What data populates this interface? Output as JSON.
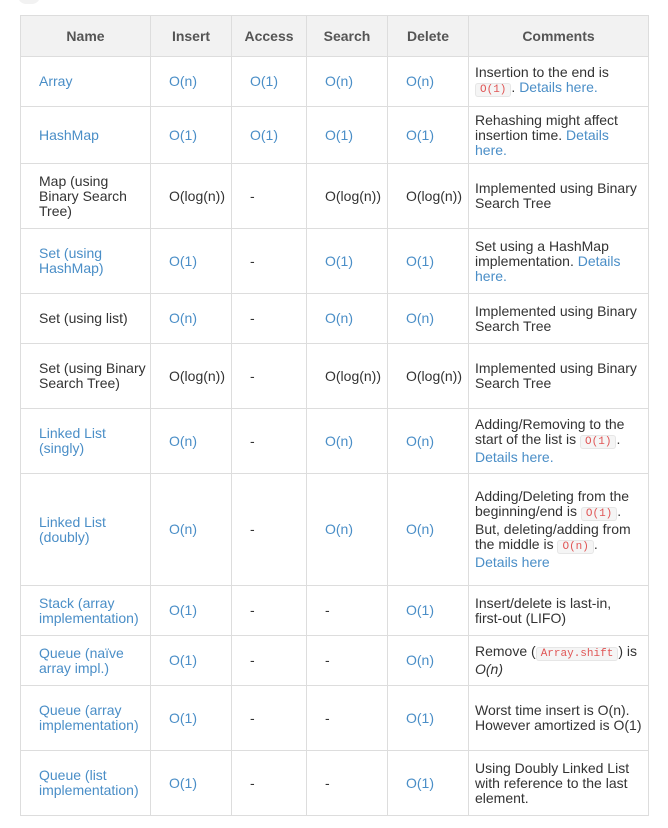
{
  "headers": [
    "Name",
    "Insert",
    "Access",
    "Search",
    "Delete",
    "Comments"
  ],
  "rows": [
    {
      "name": "Array",
      "name_link": true,
      "insert": "O(n)",
      "insert_link": true,
      "access": "O(1)",
      "access_link": true,
      "search": "O(n)",
      "search_link": true,
      "delete": "O(n)",
      "delete_link": true,
      "comment": [
        {
          "t": "text",
          "v": "Insertion to the end is "
        },
        {
          "t": "code",
          "v": "O(1)"
        },
        {
          "t": "text",
          "v": ". "
        },
        {
          "t": "link",
          "v": "Details here."
        }
      ]
    },
    {
      "name": "HashMap",
      "name_link": true,
      "insert": "O(1)",
      "insert_link": true,
      "access": "O(1)",
      "access_link": true,
      "search": "O(1)",
      "search_link": true,
      "delete": "O(1)",
      "delete_link": true,
      "comment": [
        {
          "t": "text",
          "v": "Rehashing might affect insertion time. "
        },
        {
          "t": "link",
          "v": "Details here."
        }
      ]
    },
    {
      "name": "Map (using Binary Search Tree)",
      "name_link": false,
      "insert": "O(log(n))",
      "insert_link": false,
      "access": "-",
      "access_link": false,
      "search": "O(log(n))",
      "search_link": false,
      "delete": "O(log(n))",
      "delete_link": false,
      "comment": [
        {
          "t": "text",
          "v": "Implemented using Binary Search Tree"
        }
      ]
    },
    {
      "name": "Set (using HashMap)",
      "name_link": true,
      "insert": "O(1)",
      "insert_link": true,
      "access": "-",
      "access_link": false,
      "search": "O(1)",
      "search_link": true,
      "delete": "O(1)",
      "delete_link": true,
      "comment": [
        {
          "t": "text",
          "v": "Set using a HashMap implementation. "
        },
        {
          "t": "link",
          "v": "Details here."
        }
      ]
    },
    {
      "name": "Set (using list)",
      "name_link": false,
      "insert": "O(n)",
      "insert_link": true,
      "access": "-",
      "access_link": false,
      "search": "O(n)",
      "search_link": true,
      "delete": "O(n)",
      "delete_link": true,
      "comment": [
        {
          "t": "text",
          "v": "Implemented using Binary Search Tree"
        }
      ]
    },
    {
      "name": "Set (using Binary Search Tree)",
      "name_link": false,
      "insert": "O(log(n))",
      "insert_link": false,
      "access": "-",
      "access_link": false,
      "search": "O(log(n))",
      "search_link": false,
      "delete": "O(log(n))",
      "delete_link": false,
      "comment": [
        {
          "t": "text",
          "v": "Implemented using Binary Search Tree"
        }
      ]
    },
    {
      "name": "Linked List (singly)",
      "name_link": true,
      "insert": "O(n)",
      "insert_link": true,
      "access": "-",
      "access_link": false,
      "search": "O(n)",
      "search_link": true,
      "delete": "O(n)",
      "delete_link": true,
      "comment": [
        {
          "t": "text",
          "v": "Adding/Removing to the start of the list is "
        },
        {
          "t": "code",
          "v": "O(1)"
        },
        {
          "t": "text",
          "v": ". "
        },
        {
          "t": "link",
          "v": "Details here."
        }
      ]
    },
    {
      "name": "Linked List (doubly)",
      "name_link": true,
      "insert": "O(n)",
      "insert_link": true,
      "access": "-",
      "access_link": false,
      "search": "O(n)",
      "search_link": true,
      "delete": "O(n)",
      "delete_link": true,
      "comment": [
        {
          "t": "text",
          "v": "Adding/Deleting from the beginning/end is "
        },
        {
          "t": "code",
          "v": "O(1)"
        },
        {
          "t": "text",
          "v": ". But, deleting/adding from the middle is "
        },
        {
          "t": "code",
          "v": "O(n)"
        },
        {
          "t": "text",
          "v": ". "
        },
        {
          "t": "link",
          "v": "Details here"
        }
      ]
    },
    {
      "name": "Stack (array implementation)",
      "name_link": true,
      "insert": "O(1)",
      "insert_link": true,
      "access": "-",
      "access_link": false,
      "search": "-",
      "search_link": false,
      "delete": "O(1)",
      "delete_link": true,
      "comment": [
        {
          "t": "text",
          "v": "Insert/delete is last-in, first-out (LIFO)"
        }
      ]
    },
    {
      "name": "Queue (naïve array impl.)",
      "name_link": true,
      "insert": "O(1)",
      "insert_link": true,
      "access": "-",
      "access_link": false,
      "search": "-",
      "search_link": false,
      "delete": "O(n)",
      "delete_link": true,
      "comment": [
        {
          "t": "text",
          "v": "Remove ("
        },
        {
          "t": "code",
          "v": "Array.shift"
        },
        {
          "t": "text",
          "v": ") is "
        },
        {
          "t": "em",
          "v": "O(n)"
        }
      ]
    },
    {
      "name": "Queue (array implementation)",
      "name_link": true,
      "insert": "O(1)",
      "insert_link": true,
      "access": "-",
      "access_link": false,
      "search": "-",
      "search_link": false,
      "delete": "O(1)",
      "delete_link": true,
      "comment": [
        {
          "t": "text",
          "v": "Worst time insert is O(n). However amortized is O(1)"
        }
      ]
    },
    {
      "name": "Queue (list implementation)",
      "name_link": true,
      "insert": "O(1)",
      "insert_link": true,
      "access": "-",
      "access_link": false,
      "search": "-",
      "search_link": false,
      "delete": "O(1)",
      "delete_link": true,
      "comment": [
        {
          "t": "text",
          "v": "Using Doubly Linked List with reference to the last element."
        }
      ]
    }
  ],
  "colors": {
    "link": "#4a8ec7",
    "text": "#333333",
    "header_bg": "#f2f2f2",
    "border": "#dddddd",
    "code_text": "#e05555"
  }
}
